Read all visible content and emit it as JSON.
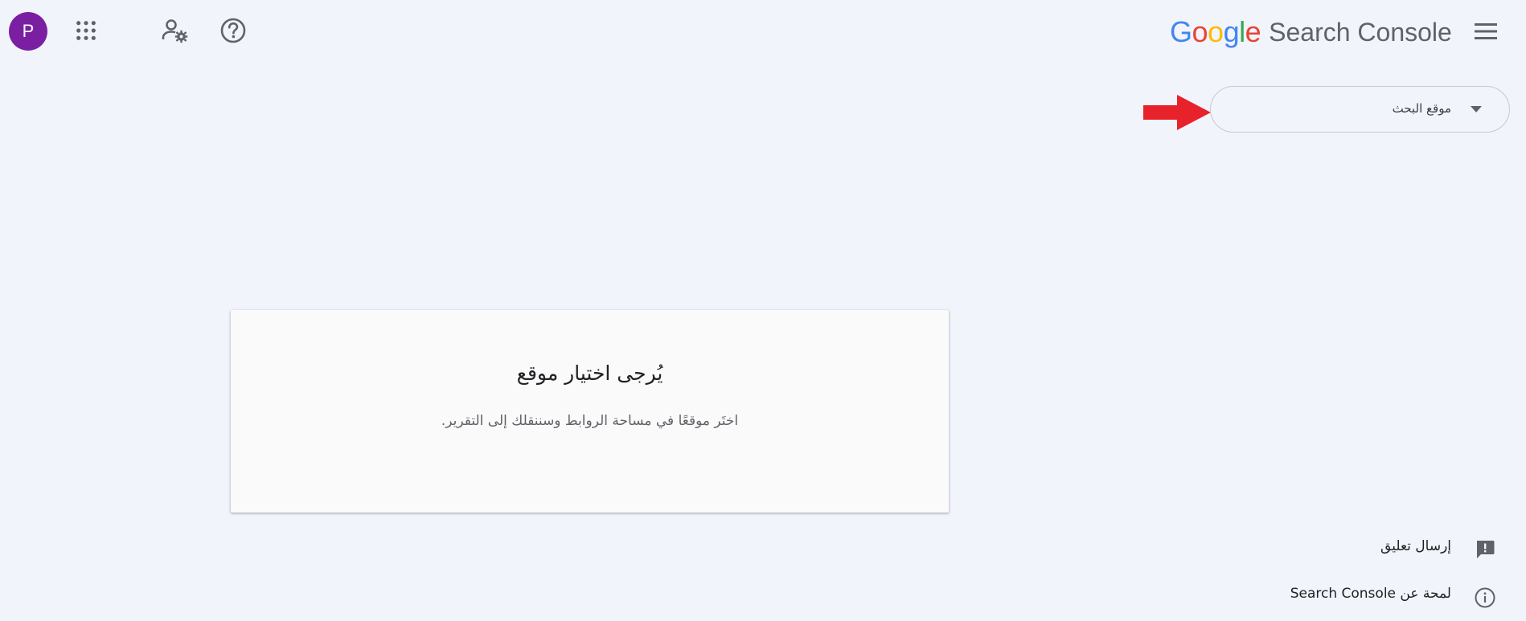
{
  "header": {
    "avatar_letter": "P",
    "avatar_color": "#7b1fa2",
    "brand_google": [
      "G",
      "o",
      "o",
      "g",
      "l",
      "e"
    ],
    "brand_product": "Search Console",
    "icons": {
      "apps": "apps-grid-icon",
      "admin": "manage-accounts-icon",
      "help": "help-icon",
      "menu": "hamburger-menu-icon"
    }
  },
  "search_property": {
    "label": "موقع البحث",
    "annotation_color": "#e8222a"
  },
  "card": {
    "title": "يُرجى اختيار موقع",
    "description": "اختَر موقعًا في مساحة الروابط وسننقلك إلى التقرير."
  },
  "footer": {
    "feedback_label": "إرسال تعليق",
    "about_label": "لمحة عن Search Console"
  }
}
